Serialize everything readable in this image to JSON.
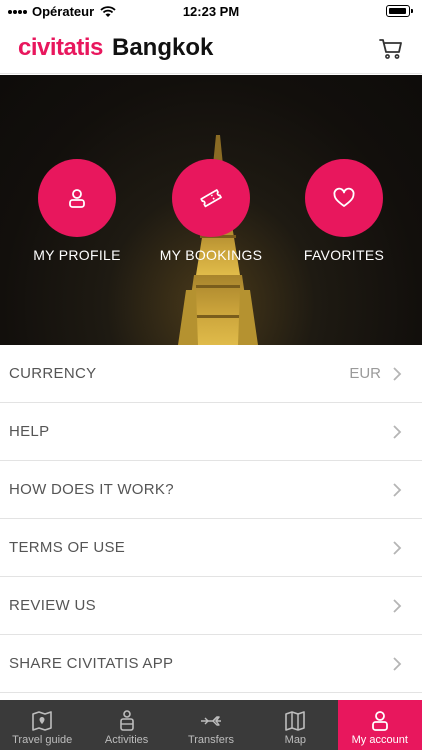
{
  "status_bar": {
    "carrier": "Opérateur",
    "time": "12:23 PM"
  },
  "header": {
    "brand": "civitatis",
    "city": "Bangkok",
    "cart_icon": "cart-icon"
  },
  "hero": {
    "buttons": [
      {
        "label": "MY PROFILE",
        "icon": "user-icon"
      },
      {
        "label": "MY BOOKINGS",
        "icon": "ticket-icon"
      },
      {
        "label": "FAVORITES",
        "icon": "heart-icon"
      }
    ]
  },
  "menu": {
    "items": [
      {
        "label": "CURRENCY",
        "value": "EUR"
      },
      {
        "label": "HELP",
        "value": ""
      },
      {
        "label": "HOW DOES IT WORK?",
        "value": ""
      },
      {
        "label": "TERMS OF USE",
        "value": ""
      },
      {
        "label": "REVIEW US",
        "value": ""
      },
      {
        "label": "SHARE CIVITATIS APP",
        "value": ""
      }
    ]
  },
  "tabbar": {
    "tabs": [
      {
        "label": "Travel guide",
        "icon": "book-map-icon"
      },
      {
        "label": "Activities",
        "icon": "guide-person-icon"
      },
      {
        "label": "Transfers",
        "icon": "plane-transfer-icon"
      },
      {
        "label": "Map",
        "icon": "map-icon"
      },
      {
        "label": "My account",
        "icon": "user-icon",
        "active": true
      }
    ]
  },
  "colors": {
    "accent": "#e8175d",
    "tabbar_bg": "#3a3a3a"
  }
}
